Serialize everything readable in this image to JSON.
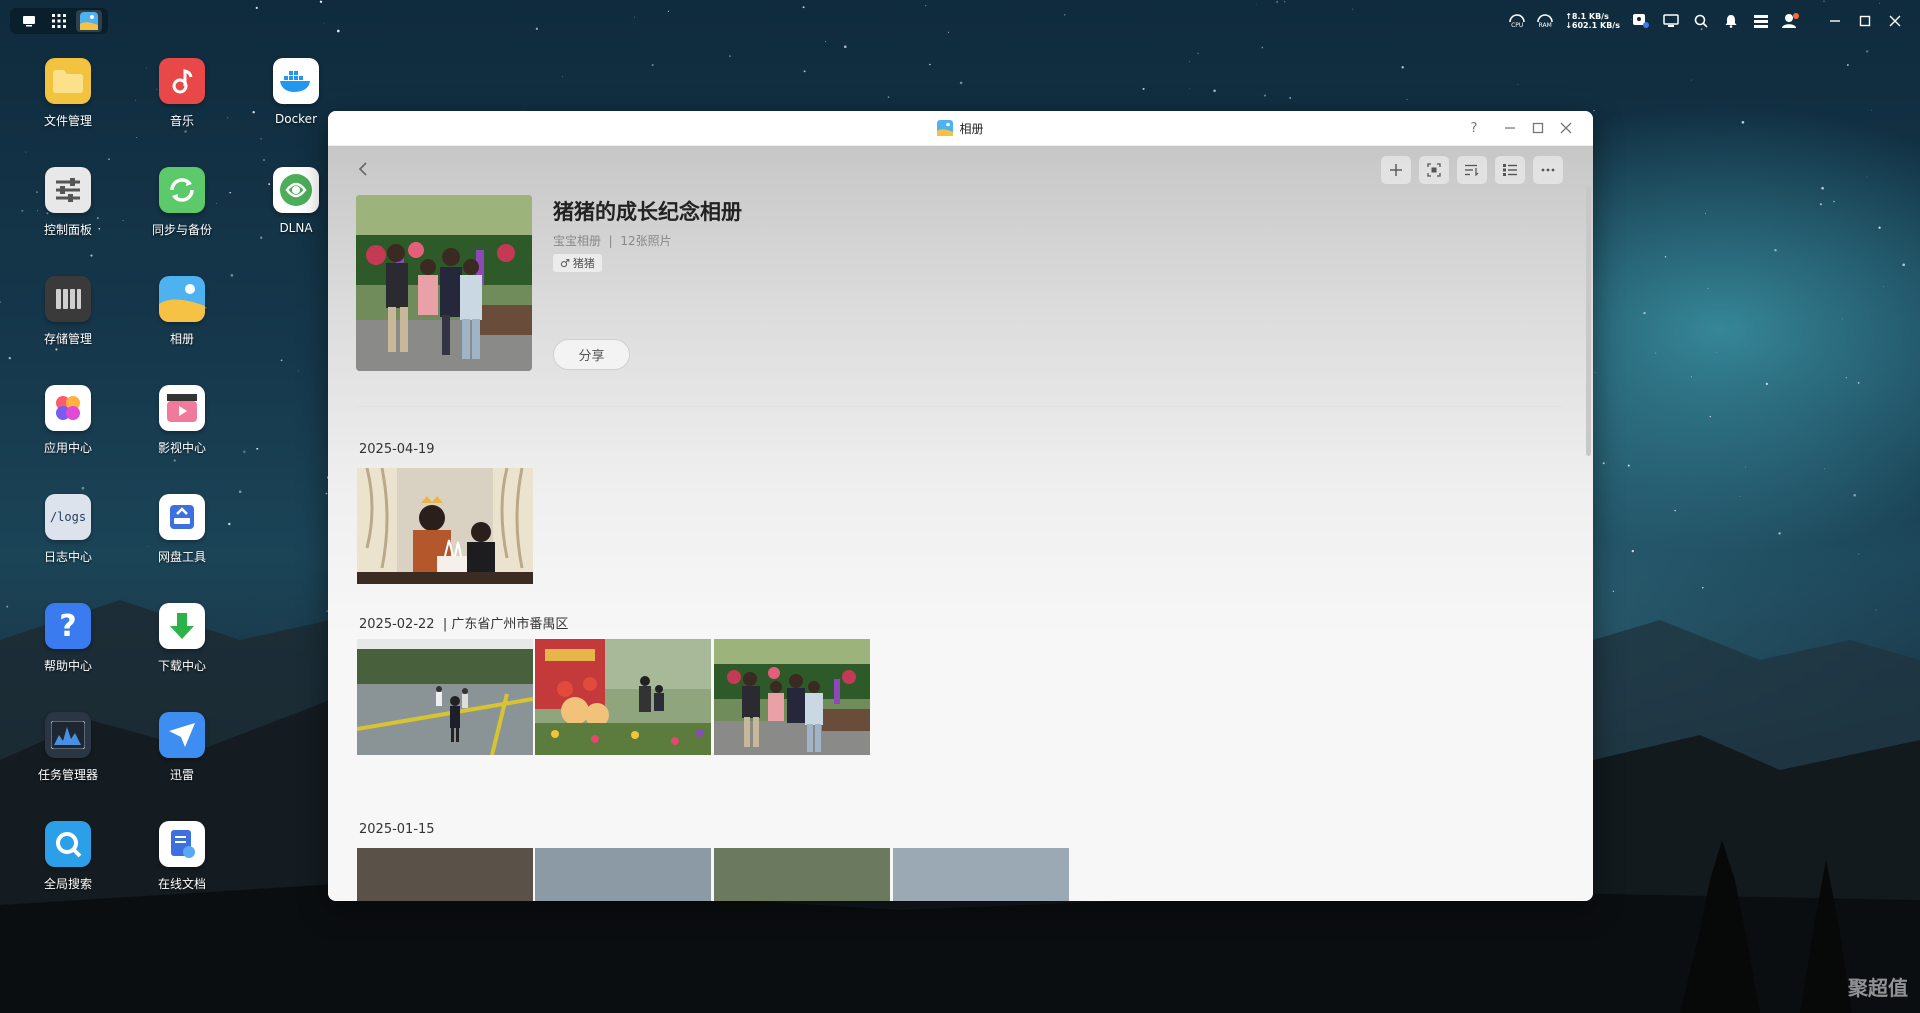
{
  "topbar": {
    "net_up": "8.1 KB/s",
    "net_down": "602.1 KB/s",
    "cpu_label": "CPU",
    "ram_label": "RAM"
  },
  "desktop": {
    "icons": [
      {
        "label": "文件管理",
        "icon": "folder-icon",
        "color": "#f3c23f"
      },
      {
        "label": "音乐",
        "icon": "music-icon",
        "color": "#e84848"
      },
      {
        "label": "Docker",
        "icon": "docker-icon",
        "color": "#ffffff"
      },
      {
        "label": "控制面板",
        "icon": "sliders-icon",
        "color": "#e8e8e8"
      },
      {
        "label": "同步与备份",
        "icon": "sync-icon",
        "color": "#5cc96a"
      },
      {
        "label": "DLNA",
        "icon": "dlna-icon",
        "color": "#ffffff"
      },
      {
        "label": "存储管理",
        "icon": "storage-icon",
        "color": "#3a3a3a"
      },
      {
        "label": "相册",
        "icon": "photo-album-icon",
        "color": "#ffffff"
      },
      {
        "label": "应用中心",
        "icon": "app-center-icon",
        "color": "#ffffff"
      },
      {
        "label": "影视中心",
        "icon": "video-center-icon",
        "color": "#ffffff"
      },
      {
        "label": "日志中心",
        "icon": "log-icon",
        "color": "#dce3ec"
      },
      {
        "label": "网盘工具",
        "icon": "cloud-drive-icon",
        "color": "#ffffff"
      },
      {
        "label": "帮助中心",
        "icon": "help-icon",
        "color": "#3a7cf0"
      },
      {
        "label": "下载中心",
        "icon": "download-icon",
        "color": "#ffffff"
      },
      {
        "label": "任务管理器",
        "icon": "task-manager-icon",
        "color": "#2b3644"
      },
      {
        "label": "迅雷",
        "icon": "thunder-icon",
        "color": "#3d8ef0"
      },
      {
        "label": "全局搜索",
        "icon": "global-search-icon",
        "color": "#2b9fe8"
      },
      {
        "label": "在线文档",
        "icon": "online-doc-icon",
        "color": "#ffffff"
      }
    ],
    "log_icon_text": "/logs",
    "watermark": "聚超值"
  },
  "window": {
    "title": "相册",
    "help": "?",
    "album": {
      "title": "猪猪的成长纪念相册",
      "category": "宝宝相册",
      "separator": "|",
      "count": "12张照片",
      "tag": "猪猪",
      "gender_symbol": "♂",
      "share_label": "分享"
    },
    "groups": [
      {
        "date": "2025-04-19",
        "location": ""
      },
      {
        "date": "2025-02-22",
        "location": "|  广东省广州市番禺区"
      },
      {
        "date": "2025-01-15",
        "location": ""
      }
    ]
  },
  "colors": {
    "accent": "#3a7cf0",
    "window_bg": "#ffffff"
  }
}
